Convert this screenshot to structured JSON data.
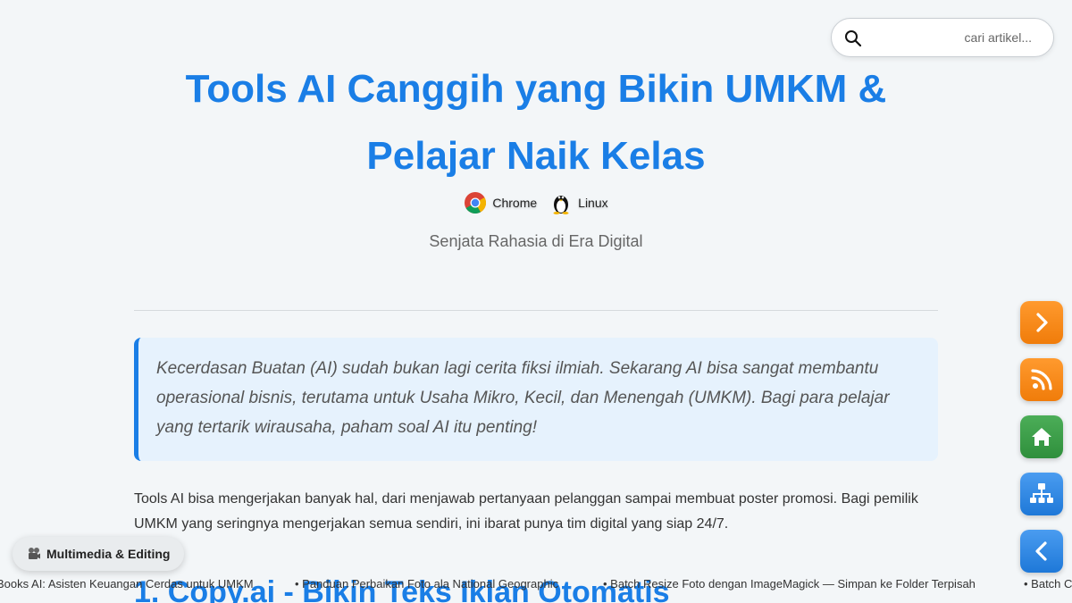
{
  "search": {
    "placeholder": "cari artikel..."
  },
  "article": {
    "title": "Tools AI Canggih yang Bikin UMKM & Pelajar Naik Kelas",
    "platforms": [
      {
        "label": "Chrome",
        "icon": "chrome-icon"
      },
      {
        "label": "Linux",
        "icon": "linux-tux-icon"
      }
    ],
    "subtitle": "Senjata Rahasia di Era Digital",
    "quote": "Kecerdasan Buatan (AI) sudah bukan lagi cerita fiksi ilmiah. Sekarang AI bisa sangat membantu operasional bisnis, terutama untuk Usaha Mikro, Kecil, dan Menengah (UMKM). Bagi para pelajar yang tertarik wirausaha, paham soal AI itu penting!",
    "intro": "Tools AI bisa mengerjakan banyak hal, dari menjawab pertanyaan pelanggan sampai membuat poster promosi. Bagi pemilik UMKM yang seringnya mengerjakan semua sendiri, ini ibarat punya tim digital yang siap 24/7.",
    "section_1_heading": "1. Copy.ai - Bikin Teks Iklan Otomatis"
  },
  "category_chip": {
    "label": "Multimedia & Editing",
    "icon": "projector-icon"
  },
  "ticker": {
    "items": [
      "Books AI: Asisten Keuangan Cerdas untuk UMKM",
      "• Panduan Perbaikan Foto ala National Geographic",
      "• Batch Resize Foto dengan ImageMagick — Simpan ke Folder Terpisah",
      "• Batch C"
    ]
  },
  "side_nav": [
    {
      "name": "next-article-button",
      "icon": "chevron-right-icon",
      "color": "#f5870f"
    },
    {
      "name": "rss-button",
      "icon": "rss-icon",
      "color": "#f5870f"
    },
    {
      "name": "home-button",
      "icon": "home-icon",
      "color": "#3a9e46"
    },
    {
      "name": "sitemap-button",
      "icon": "sitemap-icon",
      "color": "#2a86e2"
    },
    {
      "name": "previous-article-button",
      "icon": "chevron-left-icon",
      "color": "#2a86e2"
    }
  ],
  "colors": {
    "accent": "#1a7ee6",
    "quote_bg": "#e6f2fd",
    "page_bg": "#f3f6f8"
  }
}
